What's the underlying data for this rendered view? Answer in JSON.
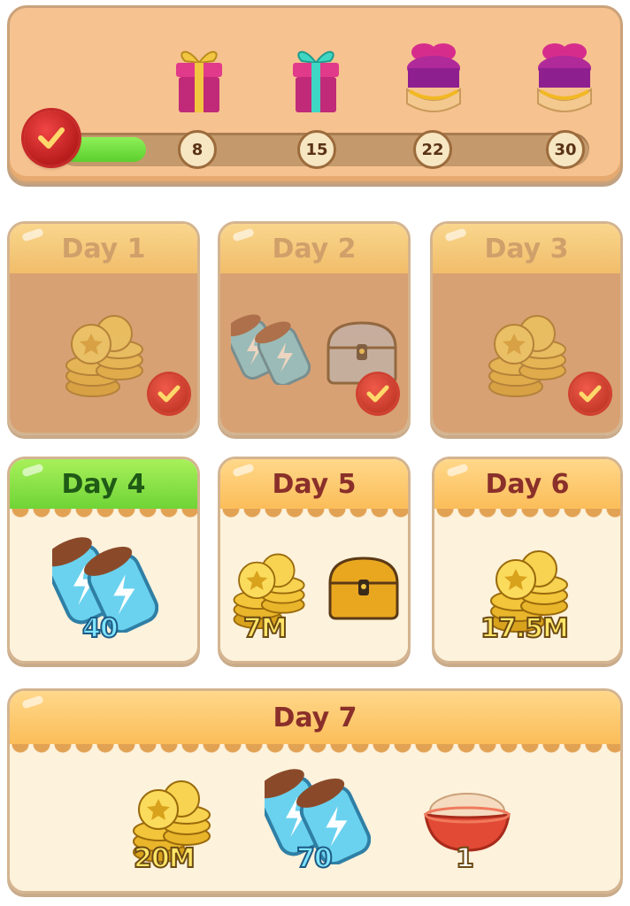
{
  "progress": {
    "fraction": 0.16,
    "milestones": [
      {
        "label": "8",
        "gift": "pink-gift-box-icon"
      },
      {
        "label": "15",
        "gift": "teal-ribbon-gift-box-icon"
      },
      {
        "label": "22",
        "gift": "purple-gift-basket-icon"
      },
      {
        "label": "30",
        "gift": "purple-gift-basket-icon"
      }
    ],
    "colors": {
      "fill": "#6fd436",
      "track": "#c49a6c",
      "seal": "#c62828"
    }
  },
  "days": [
    {
      "label": "Day 1",
      "state": "claimed",
      "rewards": [
        {
          "icon": "gold-coins-icon"
        }
      ]
    },
    {
      "label": "Day 2",
      "state": "claimed",
      "rewards": [
        {
          "icon": "energy-spins-icon"
        },
        {
          "icon": "silver-chest-icon"
        }
      ]
    },
    {
      "label": "Day 3",
      "state": "claimed",
      "rewards": [
        {
          "icon": "gold-coins-icon"
        }
      ]
    },
    {
      "label": "Day 4",
      "state": "current",
      "rewards": [
        {
          "icon": "energy-spins-icon",
          "amount": "40"
        }
      ]
    },
    {
      "label": "Day 5",
      "state": "locked",
      "rewards": [
        {
          "icon": "gold-coins-icon",
          "amount": "7M"
        },
        {
          "icon": "gold-chest-icon"
        }
      ]
    },
    {
      "label": "Day 6",
      "state": "locked",
      "rewards": [
        {
          "icon": "gold-coins-icon",
          "amount": "17.5M"
        }
      ]
    },
    {
      "label": "Day 7",
      "state": "locked",
      "rewards": [
        {
          "icon": "gold-coins-icon",
          "amount": "20M"
        },
        {
          "icon": "energy-spins-icon",
          "amount": "70"
        },
        {
          "icon": "pet-food-bowl-icon",
          "amount": "1"
        }
      ]
    }
  ]
}
